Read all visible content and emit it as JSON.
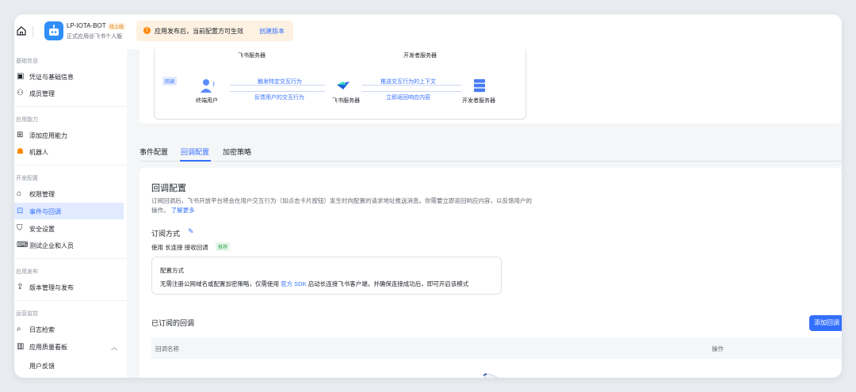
{
  "topbar": {
    "app_name": "LP-IOTA-BOT",
    "app_badge": "待上线",
    "app_subtitle": "正式应用@飞书个人版",
    "notice_text": "应用发布后，当前配置方可生效",
    "notice_link": "创建版本"
  },
  "sidebar": {
    "groups": {
      "basic": "基础信息",
      "ability": "应用能力",
      "dev": "开发配置",
      "release": "应用发布",
      "ops": "运营监控"
    },
    "items": {
      "credentials": "凭证与基础信息",
      "members": "成员管理",
      "add_ability": "添加应用能力",
      "bot": "机器人",
      "permissions": "权限管理",
      "events": "事件与回调",
      "security": "安全设置",
      "test_org": "测试企业和人员",
      "version": "版本管理与发布",
      "logs": "日志检索",
      "quality": "应用质量看板",
      "feedback": "用户反馈"
    }
  },
  "diagram": {
    "top_left_label": "飞书服务器",
    "top_right_label": "开发者服务器",
    "tag": "回调",
    "user_label": "终端用户",
    "feishu_label": "飞书服务器",
    "dev_label": "开发者服务器",
    "arrow1": "触发特定交互行为",
    "arrow2": "反馈用户的交互行为",
    "arrow3": "推送交互行为的上下文",
    "arrow4": "立即返回响应内容"
  },
  "tabs": {
    "events": "事件配置",
    "callbacks": "回调配置",
    "encryption": "加密策略"
  },
  "config": {
    "title": "回调配置",
    "desc": "订阅回调后，飞书开放平台将会在用户交互行为（如点击卡片按钮）发生时向配置的请求地址推送消息。你需要立即返回响应内容，以反馈用户的操作。",
    "learn_more": "了解更多",
    "sub_title": "订阅方式",
    "sub_line": "使用 长连接 接收回调",
    "sub_tag": "推荐",
    "mode_title": "配置方式",
    "mode_desc_pre": "无需注册公网域名或配置加密策略，仅需使用 ",
    "mode_desc_link": "官方 SDK",
    "mode_desc_post": " 启动长连接飞书客户端，并确保连接成功后，即可开启该模式",
    "subscribed_title": "已订阅的回调",
    "add_button": "添加回调",
    "col_name": "回调名称",
    "col_action": "操作"
  },
  "colors": {
    "accent": "#3370ff",
    "active_bg": "#e1eaff",
    "notice_bg": "#fdf1e2",
    "warning": "#ff8800"
  }
}
